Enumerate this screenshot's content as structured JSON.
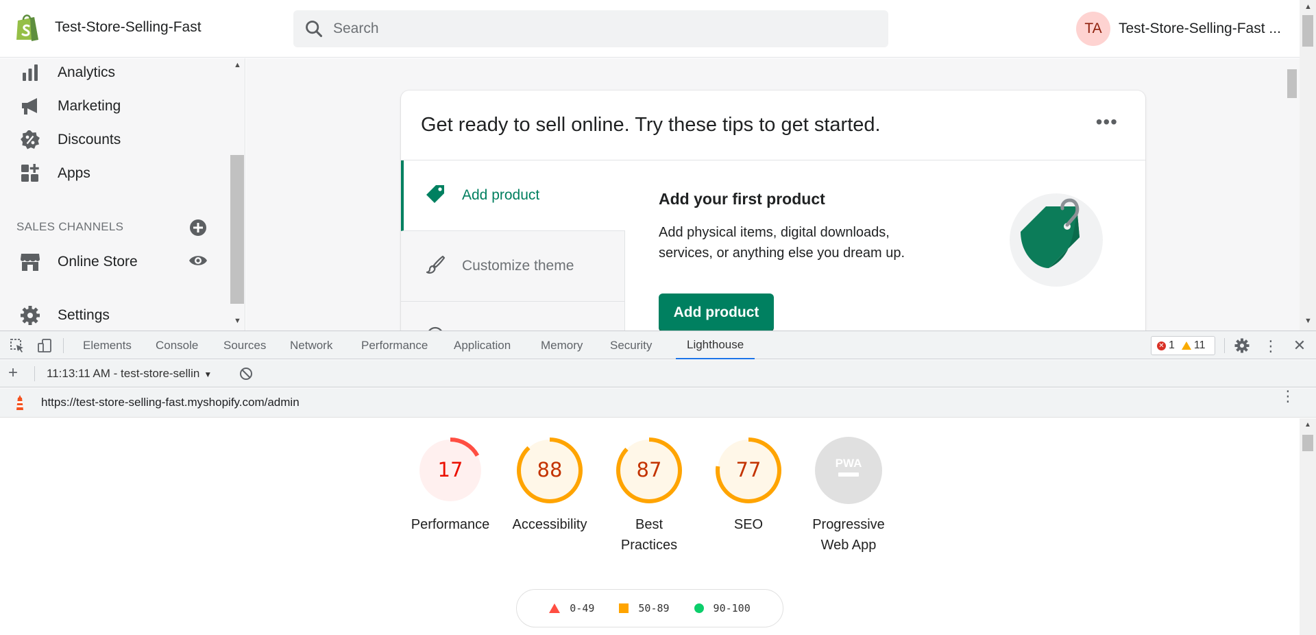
{
  "topbar": {
    "store_name": "Test-Store-Selling-Fast",
    "search_placeholder": "Search",
    "avatar_initials": "TA",
    "account_name": "Test-Store-Selling-Fast ..."
  },
  "sidebar": {
    "items": [
      {
        "label": "Analytics",
        "icon": "bar-chart-icon"
      },
      {
        "label": "Marketing",
        "icon": "megaphone-icon"
      },
      {
        "label": "Discounts",
        "icon": "discount-icon"
      },
      {
        "label": "Apps",
        "icon": "apps-icon"
      }
    ],
    "sales_channels_title": "SALES CHANNELS",
    "online_store_label": "Online Store",
    "settings_label": "Settings"
  },
  "card": {
    "title": "Get ready to sell online. Try these tips to get started.",
    "more_label": "•••",
    "tabs": [
      {
        "label": "Add product",
        "active": true
      },
      {
        "label": "Customize theme",
        "active": false
      }
    ],
    "tip_heading": "Add your first product",
    "tip_description": "Add physical items, digital downloads, services, or anything else you dream up.",
    "button_label": "Add product"
  },
  "devtools": {
    "tabs": [
      "Elements",
      "Console",
      "Sources",
      "Network",
      "Performance",
      "Application",
      "Memory",
      "Security",
      "Lighthouse"
    ],
    "active_tab": "Lighthouse",
    "error_count": "1",
    "warning_count": "11",
    "report_label": "11:13:11 AM - test-store-sellin",
    "url": "https://test-store-selling-fast.myshopify.com/admin"
  },
  "lighthouse": {
    "scores": [
      {
        "label": "Performance",
        "value": "17",
        "score": 0.17,
        "status": "fail"
      },
      {
        "label": "Accessibility",
        "value": "88",
        "score": 0.88,
        "status": "average"
      },
      {
        "label": "Best Practices",
        "value": "87",
        "score": 0.87,
        "status": "average"
      },
      {
        "label": "SEO",
        "value": "77",
        "score": 0.77,
        "status": "average"
      }
    ],
    "pwa": {
      "label": "Progressive Web App",
      "badge_text": "PWA"
    },
    "legend": {
      "fail": "0-49",
      "average": "50-89",
      "pass": "90-100"
    }
  },
  "colors": {
    "shopify_green": "#008060",
    "fail": "#ff4e42",
    "average": "#ffa400",
    "pass": "#0cce6b",
    "devtools_accent": "#1a73e8"
  }
}
